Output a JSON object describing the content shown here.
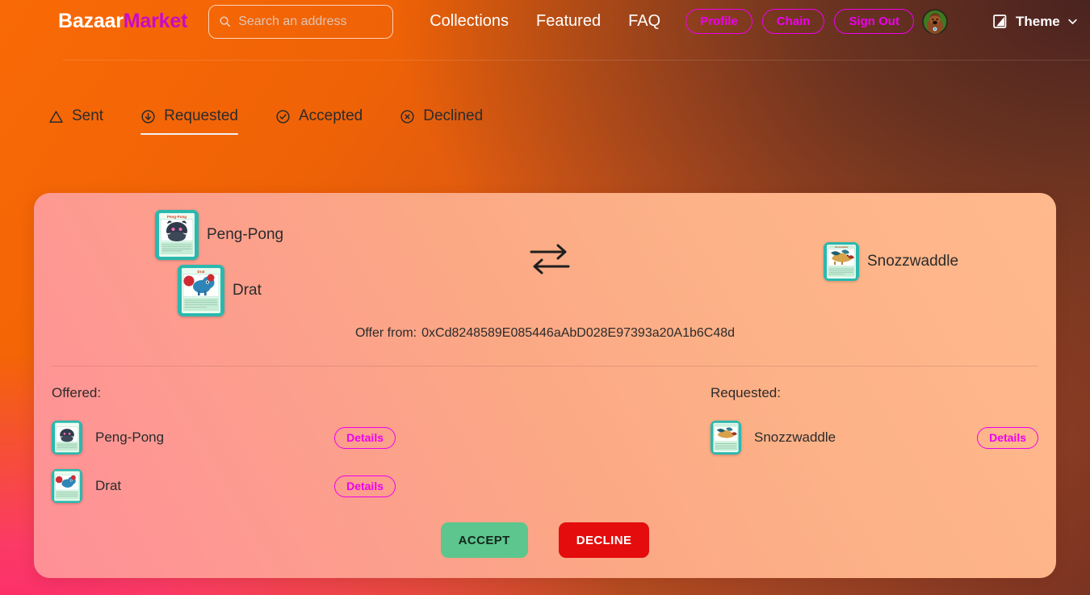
{
  "header": {
    "brand_primary": "Bazaar",
    "brand_secondary": "Market",
    "search": {
      "placeholder": "Search an address",
      "value": "",
      "icon": "search-icon"
    },
    "nav": [
      {
        "label": "Collections"
      },
      {
        "label": "Featured"
      },
      {
        "label": "FAQ"
      }
    ],
    "pills": [
      {
        "label": "Profile",
        "color": "#ee00ee"
      },
      {
        "label": "Chain",
        "color": "#ee00ee"
      },
      {
        "label": "Sign Out",
        "color": "#ee00ee"
      }
    ],
    "avatar": {
      "icon": "user-avatar"
    },
    "theme": {
      "label": "Theme",
      "icon": "contrast-page-icon",
      "chevron": "chevron-down-icon"
    }
  },
  "tabs": [
    {
      "label": "Sent",
      "icon": "warning-triangle-icon",
      "active": false
    },
    {
      "label": "Requested",
      "icon": "arrow-down-circle-icon",
      "active": true
    },
    {
      "label": "Accepted",
      "icon": "check-circle-icon",
      "active": false
    },
    {
      "label": "Declined",
      "icon": "x-circle-icon",
      "active": false
    }
  ],
  "trade": {
    "top_offered": [
      {
        "name": "Peng-Pong",
        "card": "pengpong"
      },
      {
        "name": "Drat",
        "card": "drat"
      }
    ],
    "top_requested": [
      {
        "name": "Snozzwaddle",
        "card": "snozzwaddle"
      }
    ],
    "swap_icon": "swap-arrows-icon",
    "offer_from_label": "Offer from:",
    "offer_from_address": "0xCd8248589E085446aAbD028E97393a20A1b6C48d",
    "offered": {
      "title": "Offered:",
      "items": [
        {
          "name": "Peng-Pong",
          "card": "pengpong",
          "details_label": "Details"
        },
        {
          "name": "Drat",
          "card": "drat",
          "details_label": "Details"
        }
      ]
    },
    "requested": {
      "title": "Requested:",
      "items": [
        {
          "name": "Snozzwaddle",
          "card": "snozzwaddle",
          "details_label": "Details"
        }
      ]
    },
    "accept_label": "ACCEPT",
    "decline_label": "DECLINE",
    "accept_color": "#5cc68e",
    "decline_color": "#e40c0c"
  }
}
